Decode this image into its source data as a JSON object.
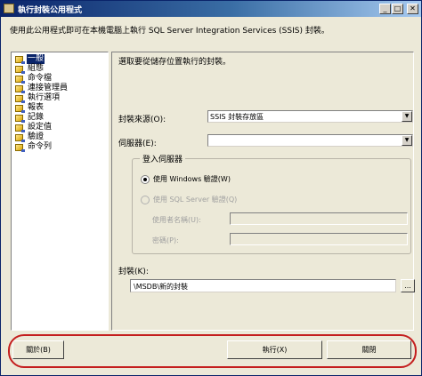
{
  "window": {
    "title": "執行封裝公用程式",
    "minimize": "_",
    "maximize": "□",
    "close": "✕"
  },
  "description": "使用此公用程式即可在本機電腦上執行 SQL Server Integration Services (SSIS) 封裝。",
  "sidebar": {
    "items": [
      {
        "label": "一般",
        "selected": true
      },
      {
        "label": "組態"
      },
      {
        "label": "命令檔"
      },
      {
        "label": "連接管理員"
      },
      {
        "label": "執行選項"
      },
      {
        "label": "報表"
      },
      {
        "label": "記錄"
      },
      {
        "label": "設定值"
      },
      {
        "label": "驗證"
      },
      {
        "label": "命令列"
      }
    ]
  },
  "general": {
    "prompt": "選取要從儲存位置執行的封裝。",
    "source_label": "封裝來源(O):",
    "source_value": "SSIS 封裝存放區",
    "server_label": "伺服器(E):",
    "server_value": "",
    "login": {
      "title": "登入伺服器",
      "windows_auth": "使用 Windows 驗證(W)",
      "sql_auth": "使用 SQL Server 驗證(Q)",
      "username_label": "使用者名稱(U):",
      "password_label": "密碼(P):"
    },
    "package_label": "封裝(K):",
    "package_value": "\\MSDB\\新的封裝",
    "browse": "..."
  },
  "footer": {
    "about": "關於(B)",
    "execute": "執行(X)",
    "close": "關閉"
  },
  "colors": {
    "highlight_oval": "#c41e1e",
    "selection": "#0a246a"
  },
  "icons": {
    "tree_item": "page-icon",
    "dropdown": "chevron-down-icon"
  }
}
